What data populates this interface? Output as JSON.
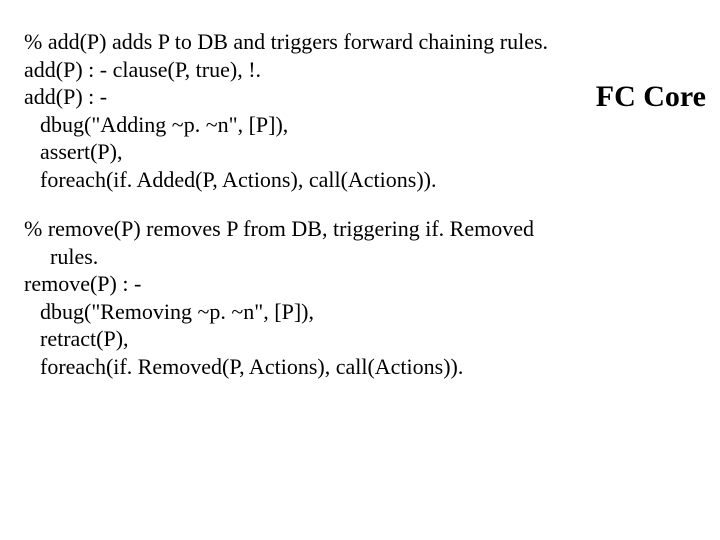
{
  "heading": "FC Core",
  "add_lines": [
    "% add(P) adds P to DB and triggers forward chaining rules.",
    "add(P) : - clause(P, true), !.",
    "add(P) : -",
    "dbug(\"Adding ~p. ~n\", [P]),",
    "assert(P),",
    "foreach(if. Added(P, Actions), call(Actions))."
  ],
  "remove_lines": [
    "% remove(P) removes P from DB, triggering if. Removed",
    "rules.",
    "remove(P) : -",
    "dbug(\"Removing ~p. ~n\", [P]),",
    "retract(P),",
    "foreach(if. Removed(P, Actions), call(Actions))."
  ]
}
